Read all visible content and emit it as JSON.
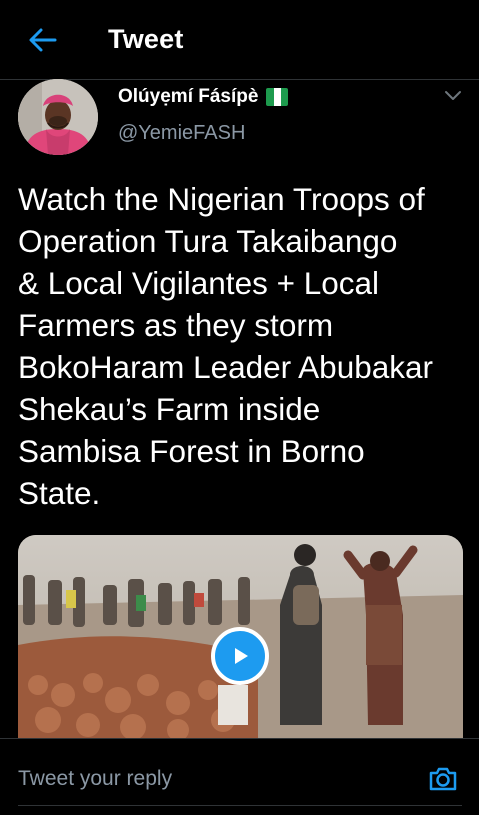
{
  "header": {
    "title": "Tweet"
  },
  "author": {
    "name": "Olúyẹmí Fásípè",
    "handle": "@YemieFASH"
  },
  "tweet": {
    "text": "Watch the Nigerian Troops of\nOperation Tura Takaibango\n& Local Vigilantes + Local\nFarmers as they  storm\nBokoHaram Leader Abubakar\nShekau’s Farm inside\nSambisa Forest in Borno\nState."
  },
  "reply": {
    "placeholder": "Tweet your reply"
  },
  "colors": {
    "accent": "#1d9bf0",
    "background": "#000000",
    "muted": "#8b98a5",
    "divider": "#2f3336"
  },
  "icons": [
    "back-arrow-icon",
    "nigeria-flag-icon",
    "chevron-down-icon",
    "play-icon",
    "camera-icon"
  ]
}
